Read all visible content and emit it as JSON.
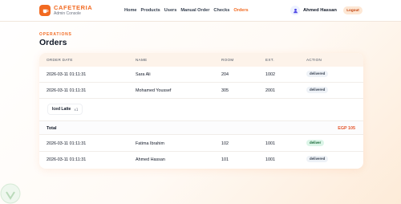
{
  "brand": {
    "name": "CAFETERIA",
    "subtitle": "Admin Console",
    "accent": "#f26a21"
  },
  "nav": {
    "items": [
      {
        "label": "Home"
      },
      {
        "label": "Products"
      },
      {
        "label": "Users"
      },
      {
        "label": "Manual Order"
      },
      {
        "label": "Checks"
      },
      {
        "label": "Orders",
        "active": true
      }
    ]
  },
  "user": {
    "name": "Ahmed Hassan",
    "avatar_icon": "user-icon",
    "logout_label": "Logout"
  },
  "page": {
    "eyebrow": "OPERATIONS",
    "title": "Orders"
  },
  "table": {
    "headers": {
      "date": "ORDER DATE",
      "name": "NAME",
      "room": "ROOM",
      "ext": "EXT.",
      "action": "ACTION"
    },
    "rows": [
      {
        "date": "2026-03-11 01:11:31",
        "name": "Sara Ali",
        "room": "204",
        "ext": "1002",
        "status": "delivered"
      },
      {
        "date": "2026-03-11 01:11:31",
        "name": "Mohamed Youssef",
        "room": "305",
        "ext": "2001",
        "status": "delivered"
      },
      {
        "date": "2026-03-11 01:11:31",
        "name": "Fatima Ibrahim",
        "room": "102",
        "ext": "1001",
        "status": "deliver"
      },
      {
        "date": "2026-03-11 01:11:31",
        "name": "Ahmed Hassan",
        "room": "101",
        "ext": "1001",
        "status": "delivered"
      }
    ],
    "detail": {
      "item_name": "Iced Latte",
      "item_qty": "x1"
    },
    "total": {
      "label": "Total",
      "value": "EGP 105"
    }
  }
}
